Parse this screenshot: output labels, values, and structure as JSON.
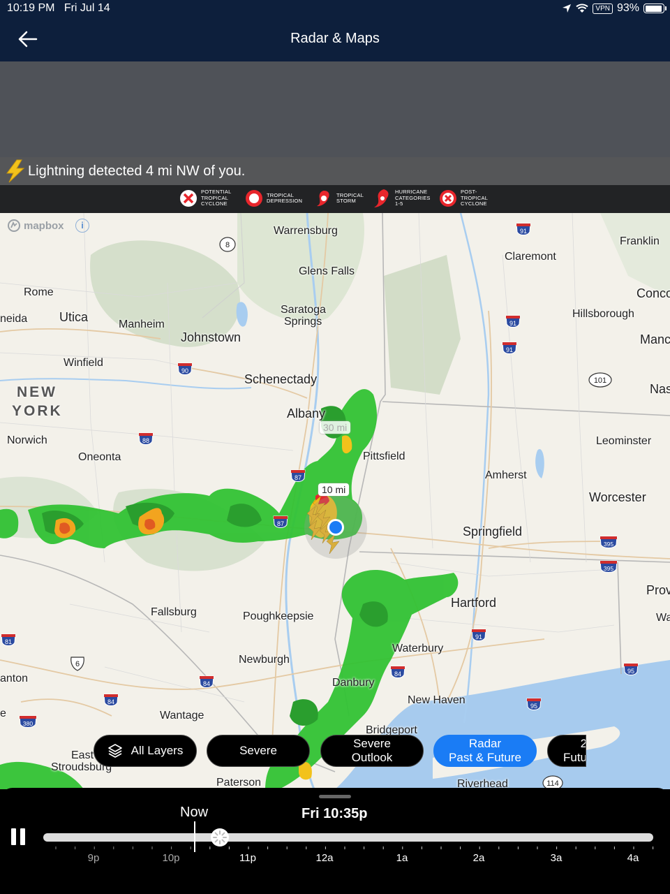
{
  "status": {
    "time": "10:19 PM",
    "date": "Fri Jul 14",
    "vpn": "VPN",
    "battery": "93%",
    "battery_level": 0.93
  },
  "nav": {
    "title": "Radar & Maps",
    "back_icon": "back-arrow-icon"
  },
  "alert": {
    "text": "Lightning detected 4 mi NW of you.",
    "icon": "lightning-icon"
  },
  "legend": [
    {
      "key": "ptc",
      "lines": [
        "POTENTIAL",
        "TROPICAL",
        "CYCLONE"
      ]
    },
    {
      "key": "td",
      "lines": [
        "TROPICAL",
        "DEPRESSION"
      ]
    },
    {
      "key": "ts",
      "lines": [
        "TROPICAL",
        "STORM"
      ]
    },
    {
      "key": "hur",
      "lines": [
        "HURRICANE",
        "CATEGORIES",
        "1-5"
      ]
    },
    {
      "key": "post",
      "lines": [
        "POST-",
        "TROPICAL",
        "CYCLONE"
      ]
    }
  ],
  "map": {
    "attribution": "mapbox",
    "info": "i",
    "ring_labels": {
      "outer": "30 mi",
      "inner": "10 mi"
    },
    "cities": {
      "warrensburg": "Warrensburg",
      "glens_falls": "Glens Falls",
      "saratoga": "Saratoga",
      "springs": "Springs",
      "rome": "Rome",
      "utica": "Utica",
      "oneida": "neida",
      "manheim": "Manheim",
      "johnstown": "Johnstown",
      "winfield": "Winfield",
      "schenectady": "Schenectady",
      "albany": "Albany",
      "norwich": "Norwich",
      "oneonta": "Oneonta",
      "pittsfield": "Pittsfield",
      "claremont": "Claremont",
      "franklin": "Franklin",
      "concord": "Conco",
      "hillsborough": "Hillsborough",
      "manchester": "Manc",
      "nashua": "Nas",
      "leominster": "Leominster",
      "amherst": "Amherst",
      "worcester": "Worcester",
      "springfield": "Springfield",
      "hartford": "Hartford",
      "providence": "Prov",
      "warwick": "Wa",
      "waterbury": "Waterbury",
      "new_haven": "New Haven",
      "danbury": "Danbury",
      "bridgeport": "Bridgeport",
      "riverhead": "Riverhead",
      "fallsburg": "Fallsburg",
      "poughkeepsie": "Poughkeepsie",
      "newburgh": "Newburgh",
      "wantage": "Wantage",
      "paterson": "Paterson",
      "east": "East",
      "stroudsburg": "Stroudsburg",
      "scranton": "anton",
      "ne": "e"
    },
    "state_name": [
      "NEW",
      "YORK"
    ],
    "shields": {
      "i91": "91",
      "i90": "90",
      "i87": "87",
      "i88": "88",
      "i84": "84",
      "i81": "81",
      "i395": "395",
      "i95": "95",
      "i380": "380",
      "r8": "8",
      "r101": "101",
      "r114": "114",
      "us6": "6"
    }
  },
  "chips": [
    {
      "label": "All Layers",
      "icon": "layers-icon"
    },
    {
      "label": "Severe"
    },
    {
      "label": "Severe\nOutlook"
    },
    {
      "label": "Radar\nPast & Future",
      "active": true
    },
    {
      "label": "2\nFutu"
    }
  ],
  "timeline": {
    "now_label": "Now",
    "current_time": "Fri 10:35p",
    "hours": [
      "9p",
      "10p",
      "11p",
      "12a",
      "1a",
      "2a",
      "3a",
      "4a"
    ],
    "playback_state": "pause"
  }
}
